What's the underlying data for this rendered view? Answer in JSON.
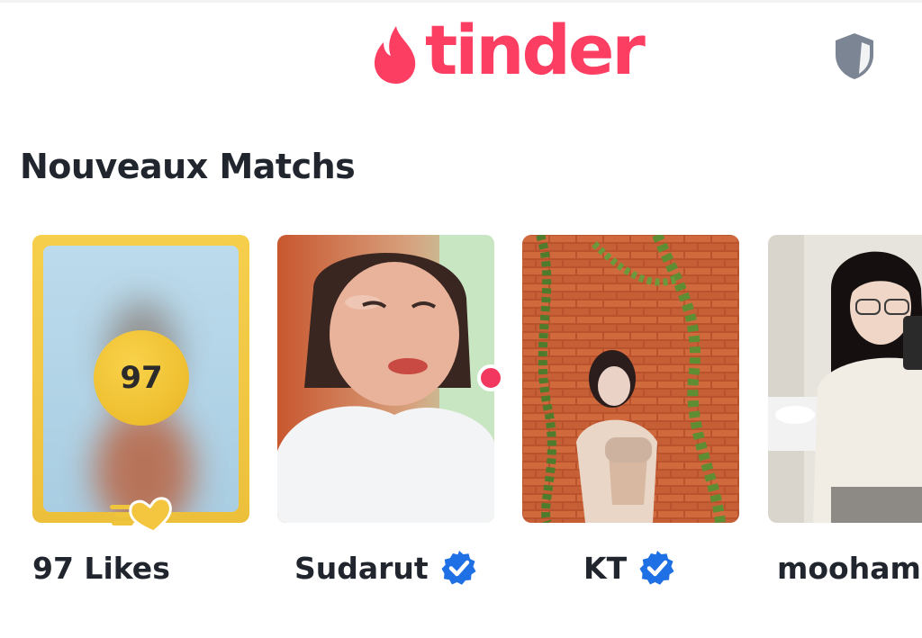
{
  "header": {
    "logo_text": "tinder",
    "logo_icon": "flame-icon",
    "safety_icon": "shield-icon",
    "brand_color": "#fd3e63"
  },
  "section": {
    "title": "Nouveaux Matchs"
  },
  "likes_card": {
    "count": "97",
    "label": "97 Likes",
    "accent_color": "#f0c53e"
  },
  "matches": [
    {
      "name": "Sudarut",
      "verified": true,
      "new_indicator": true
    },
    {
      "name": "KT",
      "verified": true,
      "new_indicator": false
    },
    {
      "name": "mooham",
      "verified": false,
      "new_indicator": false
    }
  ],
  "colors": {
    "verified_badge": "#1f6fe5",
    "new_dot": "#f2385e",
    "text": "#21262e",
    "shield": "#7c8594"
  }
}
